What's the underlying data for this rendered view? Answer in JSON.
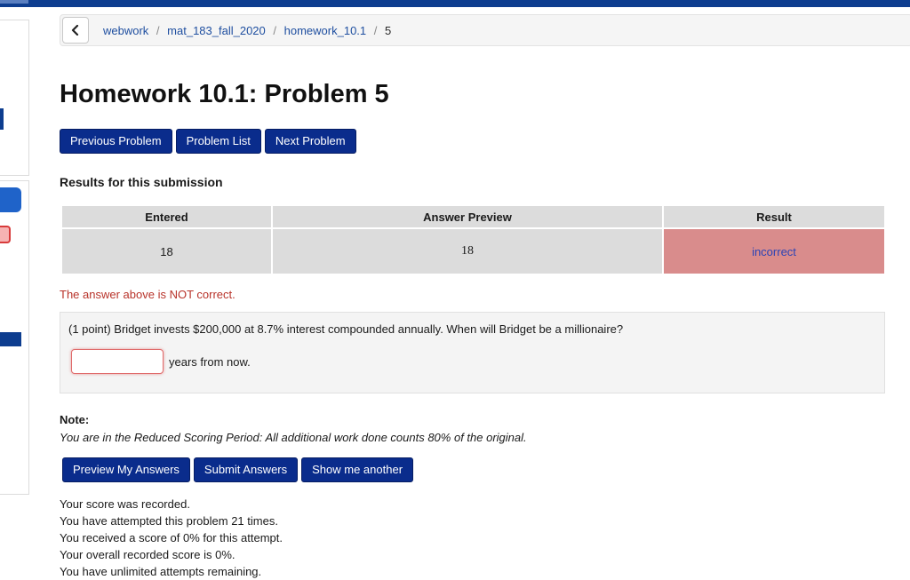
{
  "breadcrumb": {
    "back_icon": "chevron-left-icon",
    "items": [
      "webwork",
      "mat_183_fall_2020",
      "homework_10.1",
      "5"
    ],
    "separator": "/"
  },
  "page_title": "Homework 10.1: Problem 5",
  "nav": {
    "previous": "Previous Problem",
    "list": "Problem List",
    "next": "Next Problem"
  },
  "results": {
    "heading": "Results for this submission",
    "columns": [
      "Entered",
      "Answer Preview",
      "Result"
    ],
    "row": {
      "entered": "18",
      "preview": "18",
      "result": "incorrect"
    },
    "message": "The answer above is NOT correct."
  },
  "problem": {
    "text": "(1 point) Bridget invests $200,000 at 8.7% interest compounded annually. When will Bridget be a millionaire?",
    "answer_value": "",
    "after_input": "years from now."
  },
  "note": {
    "label": "Note:",
    "text": "You are in the Reduced Scoring Period: All additional work done counts 80% of the original."
  },
  "actions": {
    "preview": "Preview My Answers",
    "submit": "Submit Answers",
    "another": "Show me another"
  },
  "status_lines": [
    "Your score was recorded.",
    "You have attempted this problem 21 times.",
    "You received a score of 0% for this attempt.",
    "Your overall recorded score is 0%.",
    "You have unlimited attempts remaining."
  ],
  "colors": {
    "button_bg": "#0a2c8c",
    "incorrect_bg": "#d98c8c",
    "error_text": "#b8332a",
    "topbar": "#0d3d8f"
  }
}
